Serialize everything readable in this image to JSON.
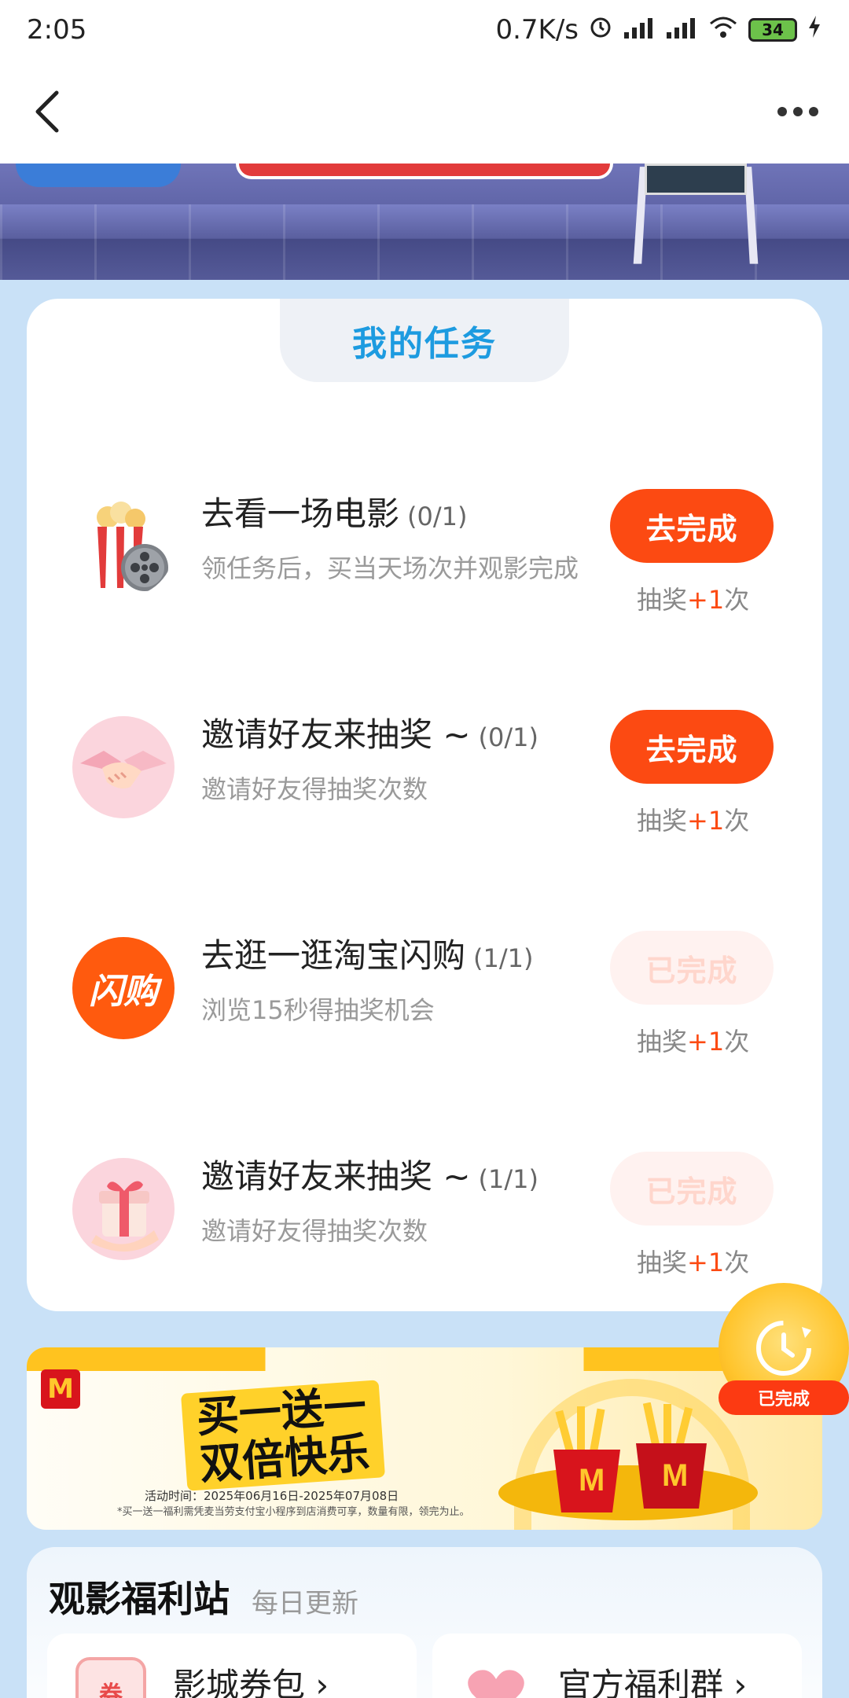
{
  "status_bar": {
    "time": "2:05",
    "network_speed": "0.7K/s",
    "battery": "34"
  },
  "task_section": {
    "title": "我的任务",
    "tasks": [
      {
        "name": "去看一场电影",
        "progress": "(0/1)",
        "desc": "领任务后，买当天场次并观影完成",
        "button": "去完成",
        "reward_prefix": "抽奖",
        "reward_plus": "+1",
        "reward_suffix": "次",
        "icon": "popcorn-film-icon",
        "completed": false
      },
      {
        "name": "邀请好友来抽奖 ~",
        "progress": "(0/1)",
        "desc": "邀请好友得抽奖次数",
        "button": "去完成",
        "reward_prefix": "抽奖",
        "reward_plus": "+1",
        "reward_suffix": "次",
        "icon": "handshake-icon",
        "completed": false
      },
      {
        "name": "去逛一逛淘宝闪购",
        "progress": "(1/1)",
        "desc": "浏览15秒得抽奖机会",
        "button": "已完成",
        "reward_prefix": "抽奖",
        "reward_plus": "+1",
        "reward_suffix": "次",
        "icon": "shangou-logo-icon",
        "icon_text": "闪购",
        "completed": true
      },
      {
        "name": "邀请好友来抽奖 ~",
        "progress": "(1/1)",
        "desc": "邀请好友得抽奖次数",
        "button": "已完成",
        "reward_prefix": "抽奖",
        "reward_plus": "+1",
        "reward_suffix": "次",
        "icon": "gift-box-icon",
        "completed": true
      }
    ]
  },
  "floating_badge": {
    "label": "已完成"
  },
  "promo": {
    "logo": "M",
    "headline_line1": "买一送一",
    "headline_line2": "双倍快乐",
    "activity_time": "活动时间：2025年06月16日-2025年07月08日",
    "fine_print": "*买一送一福利需凭麦当劳支付宝小程序到店消费可享，数量有限，领完为止。"
  },
  "welfare": {
    "title": "观影福利站",
    "subtitle": "每日更新",
    "entries": [
      {
        "label": "影城券包",
        "icon_text": "券"
      },
      {
        "label": "官方福利群"
      }
    ]
  },
  "colors": {
    "accent_orange": "#fc4a12",
    "title_blue": "#1d9be0",
    "page_bg": "#c9e1f7"
  }
}
